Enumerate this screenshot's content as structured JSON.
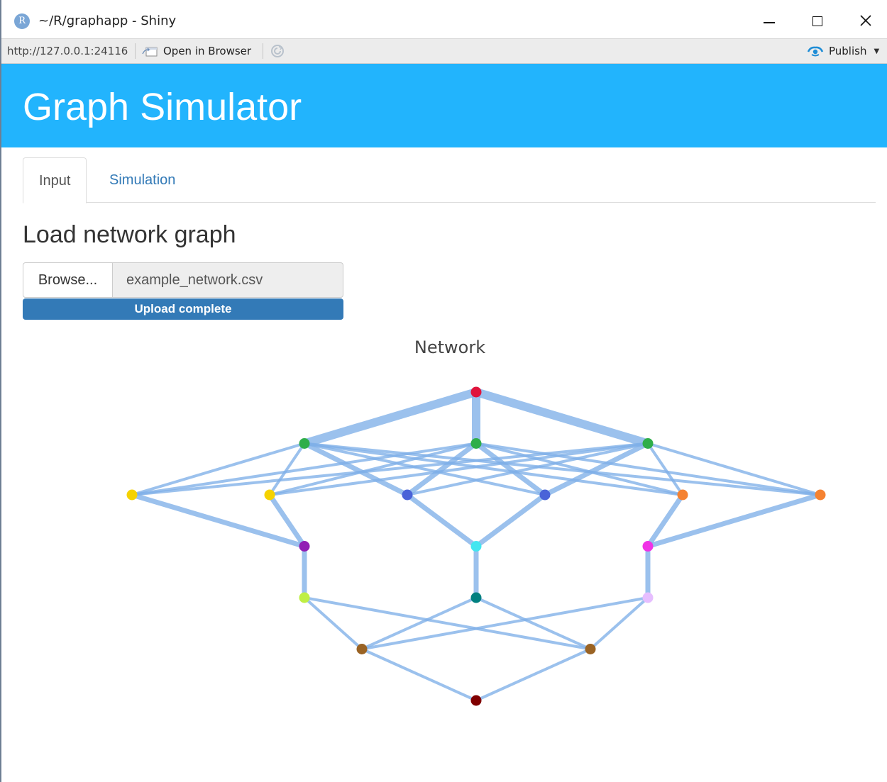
{
  "window": {
    "title": "~/R/graphapp - Shiny",
    "app_icon_letter": "R"
  },
  "toolbar": {
    "url": "http://127.0.0.1:24116",
    "open_in_browser": "Open in Browser",
    "publish": "Publish",
    "icons": [
      "open-in-browser-icon",
      "refresh-icon",
      "publish-icon",
      "caret-down-icon"
    ]
  },
  "header": {
    "title": "Graph Simulator",
    "color": "#22b4fd"
  },
  "tabs": [
    {
      "label": "Input",
      "active": true
    },
    {
      "label": "Simulation",
      "active": false
    }
  ],
  "main": {
    "section_title": "Load network graph",
    "browse_label": "Browse...",
    "file_name": "example_network.csv",
    "upload_status": "Upload complete",
    "upload_progress": 1.0
  },
  "chart_data": {
    "type": "network",
    "title": "Network",
    "edge_color": "#7fb0e8",
    "nodes": [
      {
        "id": "n1",
        "layer": 0,
        "pos": 0,
        "color": "#e0143c"
      },
      {
        "id": "n2",
        "layer": 1,
        "pos": 0,
        "color": "#2fae4a"
      },
      {
        "id": "n3",
        "layer": 1,
        "pos": 1,
        "color": "#2fae4a"
      },
      {
        "id": "n4",
        "layer": 1,
        "pos": 2,
        "color": "#2fae4a"
      },
      {
        "id": "n5",
        "layer": 2,
        "pos": 0,
        "color": "#f5d200"
      },
      {
        "id": "n6",
        "layer": 2,
        "pos": 1,
        "color": "#f5d200"
      },
      {
        "id": "n7",
        "layer": 2,
        "pos": 2,
        "color": "#4a63d8"
      },
      {
        "id": "n8",
        "layer": 2,
        "pos": 3,
        "color": "#4a63d8"
      },
      {
        "id": "n9",
        "layer": 2,
        "pos": 4,
        "color": "#f58231"
      },
      {
        "id": "n10",
        "layer": 2,
        "pos": 5,
        "color": "#f58231"
      },
      {
        "id": "n11",
        "layer": 3,
        "pos": 0,
        "color": "#911eb4"
      },
      {
        "id": "n12",
        "layer": 3,
        "pos": 1,
        "color": "#42e6f0"
      },
      {
        "id": "n13",
        "layer": 3,
        "pos": 2,
        "color": "#f032e6"
      },
      {
        "id": "n14",
        "layer": 4,
        "pos": 0,
        "color": "#bfef45"
      },
      {
        "id": "n15",
        "layer": 4,
        "pos": 1,
        "color": "#008080"
      },
      {
        "id": "n16",
        "layer": 4,
        "pos": 2,
        "color": "#e6beff"
      },
      {
        "id": "n17",
        "layer": 5,
        "pos": 0,
        "color": "#9a6324"
      },
      {
        "id": "n18",
        "layer": 5,
        "pos": 1,
        "color": "#9a6324"
      },
      {
        "id": "n19",
        "layer": 6,
        "pos": 0,
        "color": "#800000"
      }
    ],
    "edges": [
      {
        "from": "n1",
        "to": "n2",
        "weight": 3
      },
      {
        "from": "n1",
        "to": "n3",
        "weight": 3
      },
      {
        "from": "n1",
        "to": "n4",
        "weight": 3
      },
      {
        "from": "n2",
        "to": "n5",
        "weight": 1
      },
      {
        "from": "n2",
        "to": "n6",
        "weight": 1
      },
      {
        "from": "n2",
        "to": "n7",
        "weight": 2
      },
      {
        "from": "n2",
        "to": "n8",
        "weight": 1
      },
      {
        "from": "n2",
        "to": "n9",
        "weight": 1
      },
      {
        "from": "n2",
        "to": "n10",
        "weight": 1
      },
      {
        "from": "n3",
        "to": "n5",
        "weight": 1
      },
      {
        "from": "n3",
        "to": "n6",
        "weight": 1
      },
      {
        "from": "n3",
        "to": "n7",
        "weight": 2
      },
      {
        "from": "n3",
        "to": "n8",
        "weight": 2
      },
      {
        "from": "n3",
        "to": "n9",
        "weight": 1
      },
      {
        "from": "n3",
        "to": "n10",
        "weight": 1
      },
      {
        "from": "n4",
        "to": "n5",
        "weight": 1
      },
      {
        "from": "n4",
        "to": "n6",
        "weight": 1
      },
      {
        "from": "n4",
        "to": "n7",
        "weight": 1
      },
      {
        "from": "n4",
        "to": "n8",
        "weight": 2
      },
      {
        "from": "n4",
        "to": "n9",
        "weight": 1
      },
      {
        "from": "n4",
        "to": "n10",
        "weight": 1
      },
      {
        "from": "n5",
        "to": "n11",
        "weight": 2
      },
      {
        "from": "n6",
        "to": "n11",
        "weight": 2
      },
      {
        "from": "n7",
        "to": "n12",
        "weight": 2
      },
      {
        "from": "n8",
        "to": "n12",
        "weight": 2
      },
      {
        "from": "n9",
        "to": "n13",
        "weight": 2
      },
      {
        "from": "n10",
        "to": "n13",
        "weight": 2
      },
      {
        "from": "n11",
        "to": "n14",
        "weight": 2
      },
      {
        "from": "n12",
        "to": "n15",
        "weight": 2
      },
      {
        "from": "n13",
        "to": "n16",
        "weight": 2
      },
      {
        "from": "n14",
        "to": "n17",
        "weight": 1
      },
      {
        "from": "n14",
        "to": "n18",
        "weight": 1
      },
      {
        "from": "n15",
        "to": "n17",
        "weight": 1
      },
      {
        "from": "n15",
        "to": "n18",
        "weight": 1
      },
      {
        "from": "n16",
        "to": "n17",
        "weight": 1
      },
      {
        "from": "n16",
        "to": "n18",
        "weight": 1
      },
      {
        "from": "n17",
        "to": "n19",
        "weight": 1
      },
      {
        "from": "n18",
        "to": "n19",
        "weight": 1
      }
    ]
  }
}
